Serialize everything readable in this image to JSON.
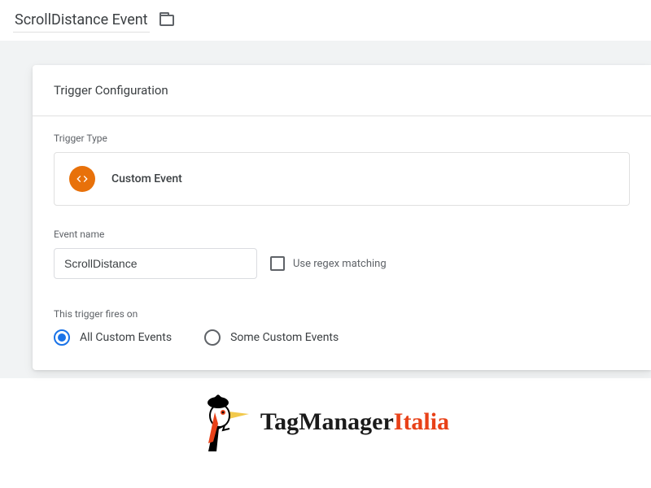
{
  "header": {
    "title": "ScrollDistance Event"
  },
  "card": {
    "section_title": "Trigger Configuration",
    "type_label": "Trigger Type",
    "type_value": "Custom Event",
    "event_label": "Event name",
    "event_value": "ScrollDistance",
    "regex_label": "Use regex matching",
    "fires_label": "This trigger fires on",
    "radio_all": "All Custom Events",
    "radio_some": "Some Custom Events"
  },
  "footer": {
    "brand1": "TagManager",
    "brand2": "Italia"
  }
}
